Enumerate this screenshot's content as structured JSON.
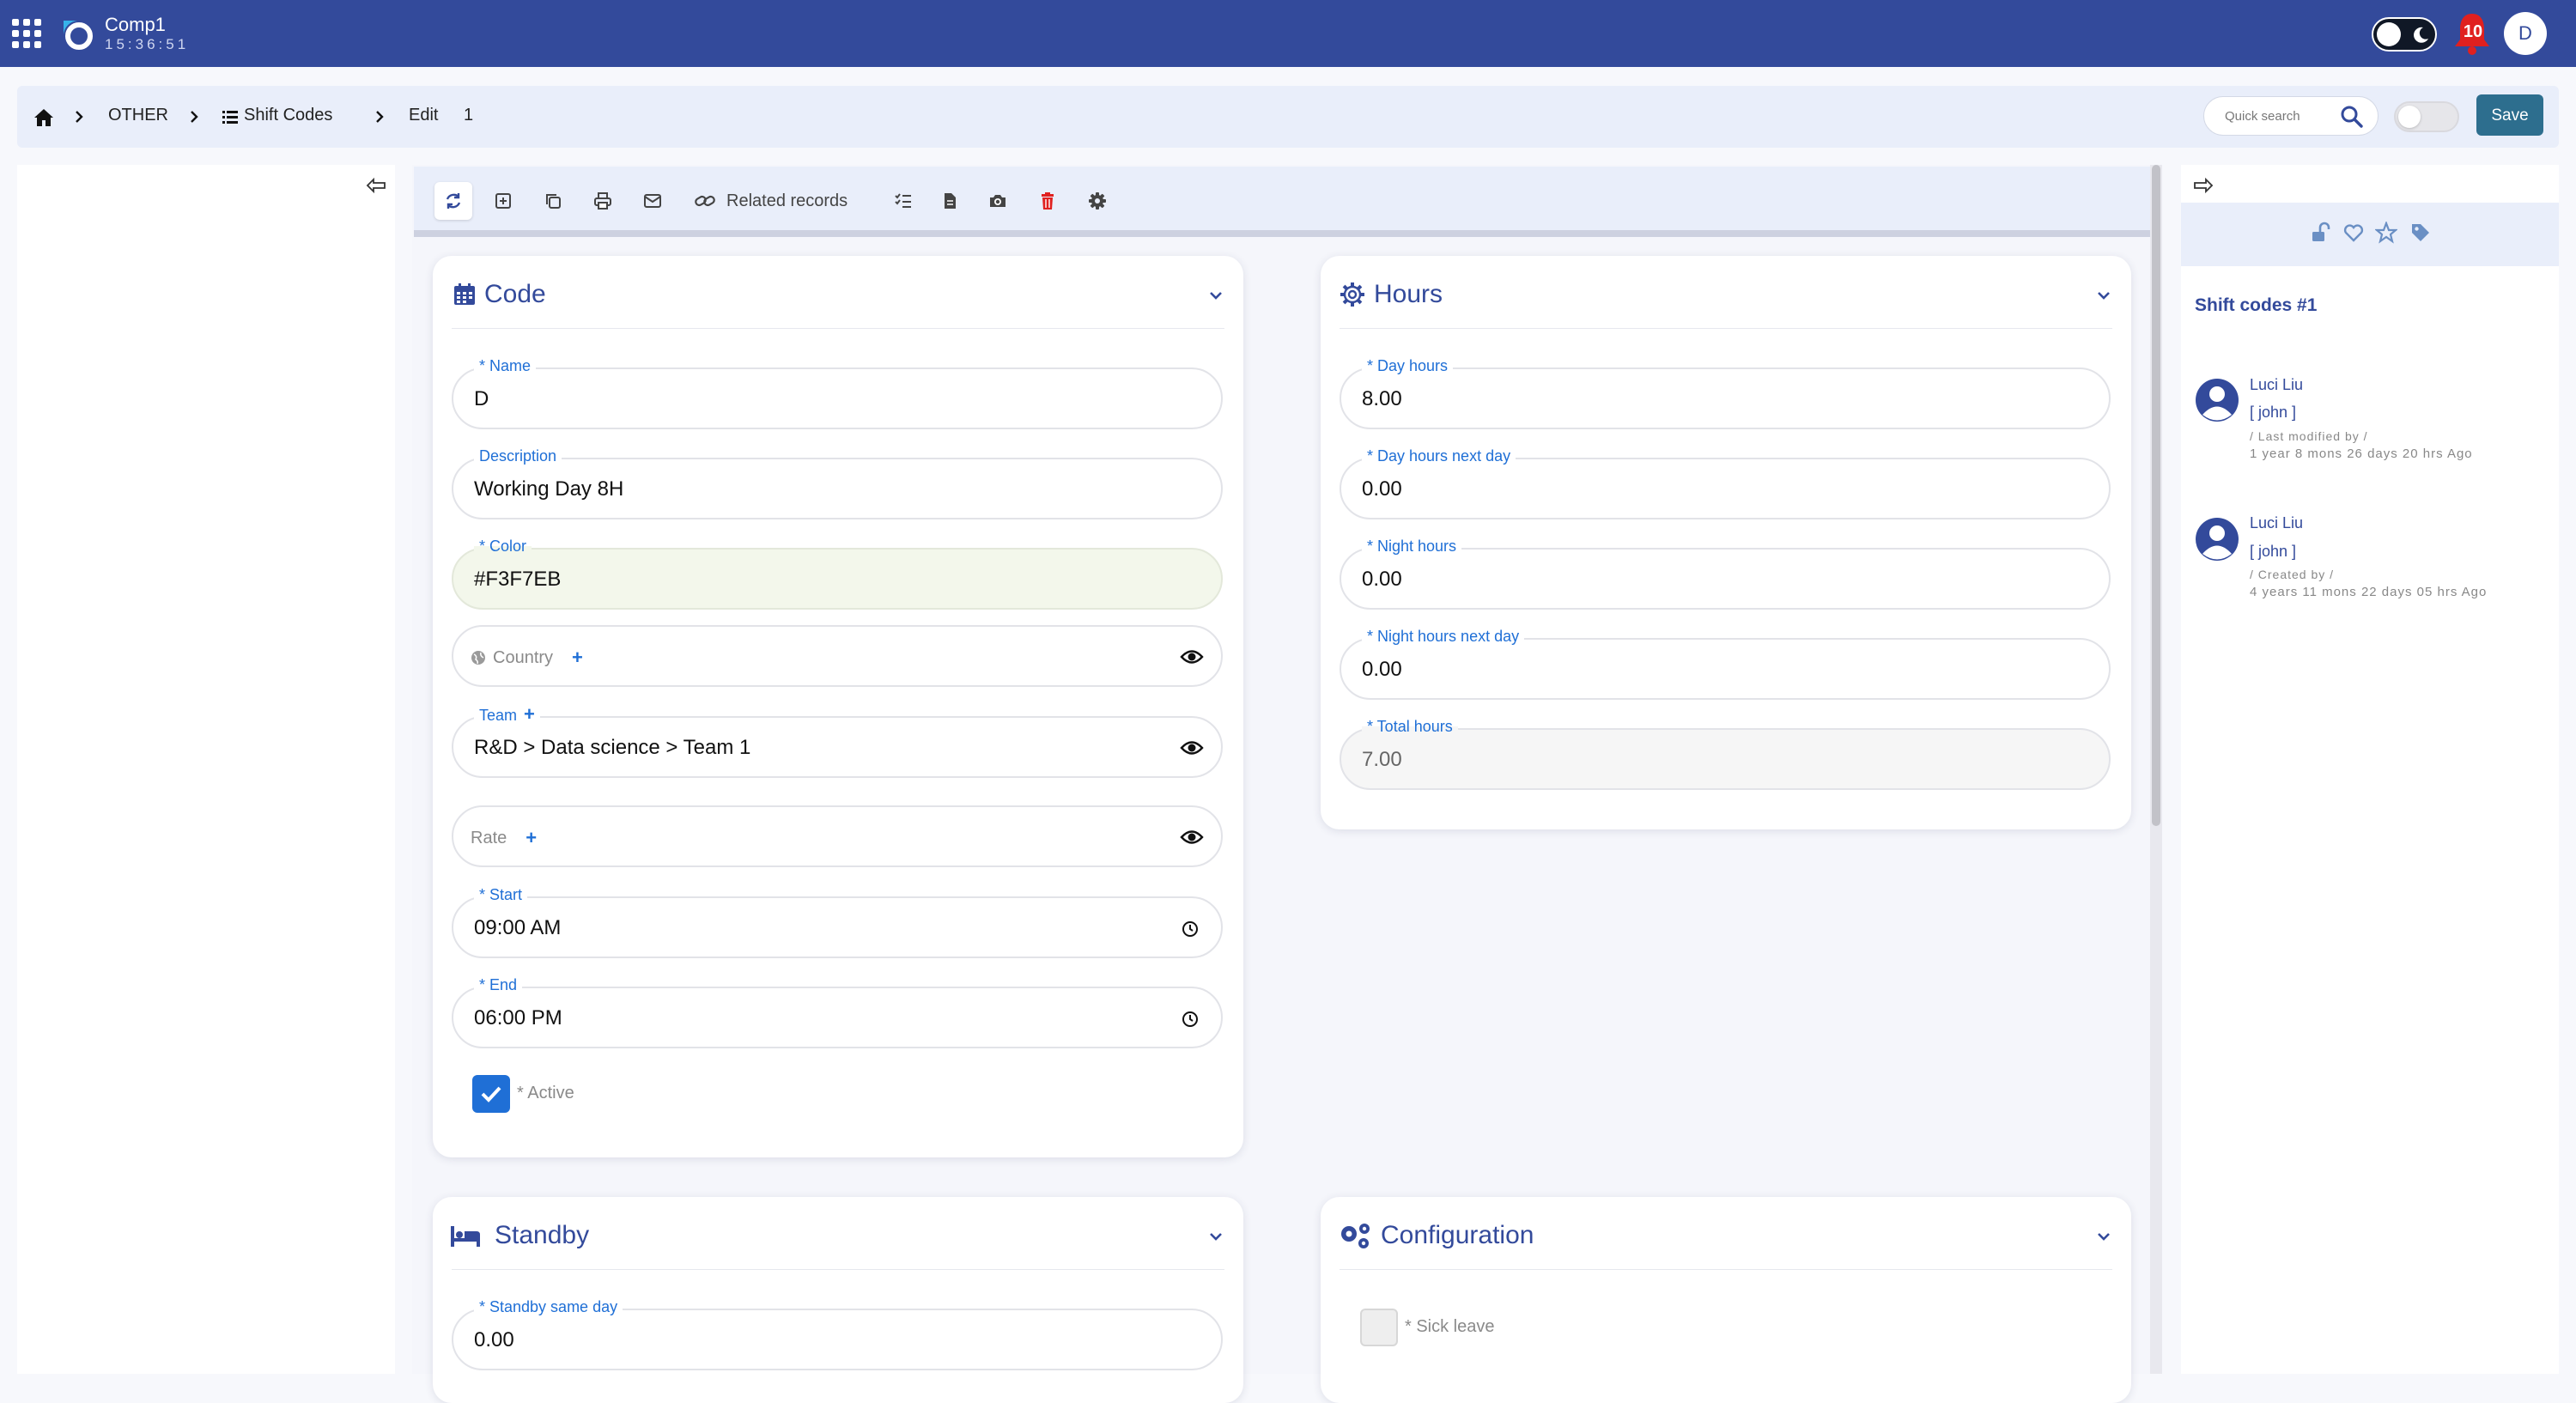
{
  "app": {
    "company": "Comp1",
    "clock": "15:36:51",
    "notifications": "10",
    "user_initial": "D"
  },
  "breadcrumb": {
    "items": [
      "OTHER",
      "Shift Codes",
      "Edit",
      "1"
    ]
  },
  "header": {
    "quick_search_placeholder": "Quick search",
    "save_label": "Save"
  },
  "toolbar": {
    "related_label": "Related records"
  },
  "code_card": {
    "title": "Code",
    "name_label": "* Name",
    "name_value": "D",
    "description_label": "Description",
    "description_value": "Working Day 8H",
    "color_label": "* Color",
    "color_value": "#F3F7EB",
    "country_placeholder": "Country",
    "team_label": "Team",
    "team_value": "R&D > Data science > Team 1",
    "rate_placeholder": "Rate",
    "start_label": "* Start",
    "start_value": "09:00 AM",
    "end_label": "* End",
    "end_value": "06:00 PM",
    "active_label": "* Active"
  },
  "hours_card": {
    "title": "Hours",
    "day_hours_label": "* Day hours",
    "day_hours_value": "8.00",
    "day_hours_next_label": "* Day hours next day",
    "day_hours_next_value": "0.00",
    "night_hours_label": "* Night hours",
    "night_hours_value": "0.00",
    "night_hours_next_label": "* Night hours next day",
    "night_hours_next_value": "0.00",
    "total_hours_label": "* Total hours",
    "total_hours_value": "7.00"
  },
  "standby_card": {
    "title": "Standby",
    "same_day_label": "* Standby same day",
    "same_day_value": "0.00"
  },
  "config_card": {
    "title": "Configuration",
    "sick_leave_label": "* Sick leave"
  },
  "right_panel": {
    "title": "Shift codes #1",
    "audit": [
      {
        "name": "Luci Liu",
        "user": "[ john ]",
        "action": "/ Last modified by /",
        "when": "1 year 8 mons 26 days 20 hrs Ago"
      },
      {
        "name": "Luci Liu",
        "user": "[ john ]",
        "action": "/ Created by /",
        "when": "4 years 11 mons 22 days 05 hrs Ago"
      }
    ]
  },
  "colors": {
    "topbar": "#334a9b",
    "accent": "#1f6fd6",
    "save": "#2d6e8e",
    "title": "#334a9b",
    "danger": "#e0201f"
  }
}
